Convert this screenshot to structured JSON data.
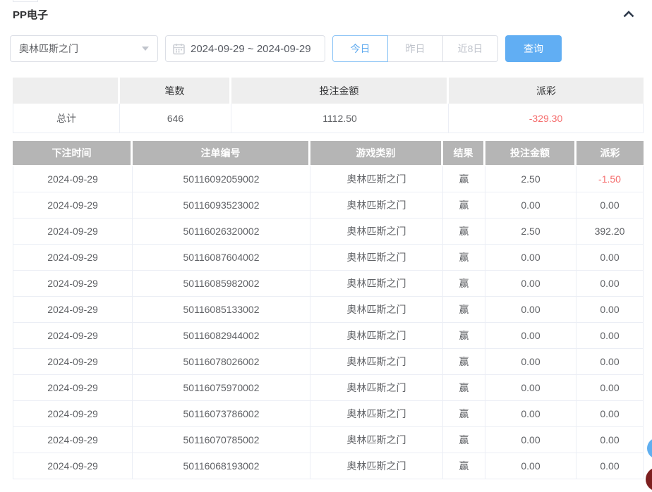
{
  "panel": {
    "title": "PP电子"
  },
  "filters": {
    "game_select": {
      "value": "奥林匹斯之门"
    },
    "date_range": {
      "value": "2024-09-29 ~ 2024-09-29"
    },
    "quick_buttons": [
      {
        "label": "今日",
        "active": true
      },
      {
        "label": "昨日",
        "active": false
      },
      {
        "label": "近8日",
        "active": false
      }
    ],
    "search_label": "查询"
  },
  "summary": {
    "headers": [
      "",
      "笔数",
      "投注金额",
      "派彩"
    ],
    "row": {
      "label": "总计",
      "count": "646",
      "bet_amount": "1112.50",
      "payout": "-329.30"
    }
  },
  "table": {
    "headers": [
      "下注时间",
      "注单编号",
      "游戏类别",
      "结果",
      "投注金额",
      "派彩"
    ],
    "rows": [
      {
        "date": "2024-09-29",
        "order_no": "50116092059002",
        "game": "奥林匹斯之门",
        "result": "赢",
        "bet": "2.50",
        "payout": "-1.50"
      },
      {
        "date": "2024-09-29",
        "order_no": "50116093523002",
        "game": "奥林匹斯之门",
        "result": "赢",
        "bet": "0.00",
        "payout": "0.00"
      },
      {
        "date": "2024-09-29",
        "order_no": "50116026320002",
        "game": "奥林匹斯之门",
        "result": "赢",
        "bet": "2.50",
        "payout": "392.20"
      },
      {
        "date": "2024-09-29",
        "order_no": "50116087604002",
        "game": "奥林匹斯之门",
        "result": "赢",
        "bet": "0.00",
        "payout": "0.00"
      },
      {
        "date": "2024-09-29",
        "order_no": "50116085982002",
        "game": "奥林匹斯之门",
        "result": "赢",
        "bet": "0.00",
        "payout": "0.00"
      },
      {
        "date": "2024-09-29",
        "order_no": "50116085133002",
        "game": "奥林匹斯之门",
        "result": "赢",
        "bet": "0.00",
        "payout": "0.00"
      },
      {
        "date": "2024-09-29",
        "order_no": "50116082944002",
        "game": "奥林匹斯之门",
        "result": "赢",
        "bet": "0.00",
        "payout": "0.00"
      },
      {
        "date": "2024-09-29",
        "order_no": "50116078026002",
        "game": "奥林匹斯之门",
        "result": "赢",
        "bet": "0.00",
        "payout": "0.00"
      },
      {
        "date": "2024-09-29",
        "order_no": "50116075970002",
        "game": "奥林匹斯之门",
        "result": "赢",
        "bet": "0.00",
        "payout": "0.00"
      },
      {
        "date": "2024-09-29",
        "order_no": "50116073786002",
        "game": "奥林匹斯之门",
        "result": "赢",
        "bet": "0.00",
        "payout": "0.00"
      },
      {
        "date": "2024-09-29",
        "order_no": "50116070785002",
        "game": "奥林匹斯之门",
        "result": "赢",
        "bet": "0.00",
        "payout": "0.00"
      },
      {
        "date": "2024-09-29",
        "order_no": "50116068193002",
        "game": "奥林匹斯之门",
        "result": "赢",
        "bet": "0.00",
        "payout": "0.00"
      }
    ]
  },
  "colors": {
    "accent_blue": "#61aef3",
    "negative_red": "#f56c6c",
    "table_header_gray": "#b5b5b5"
  }
}
